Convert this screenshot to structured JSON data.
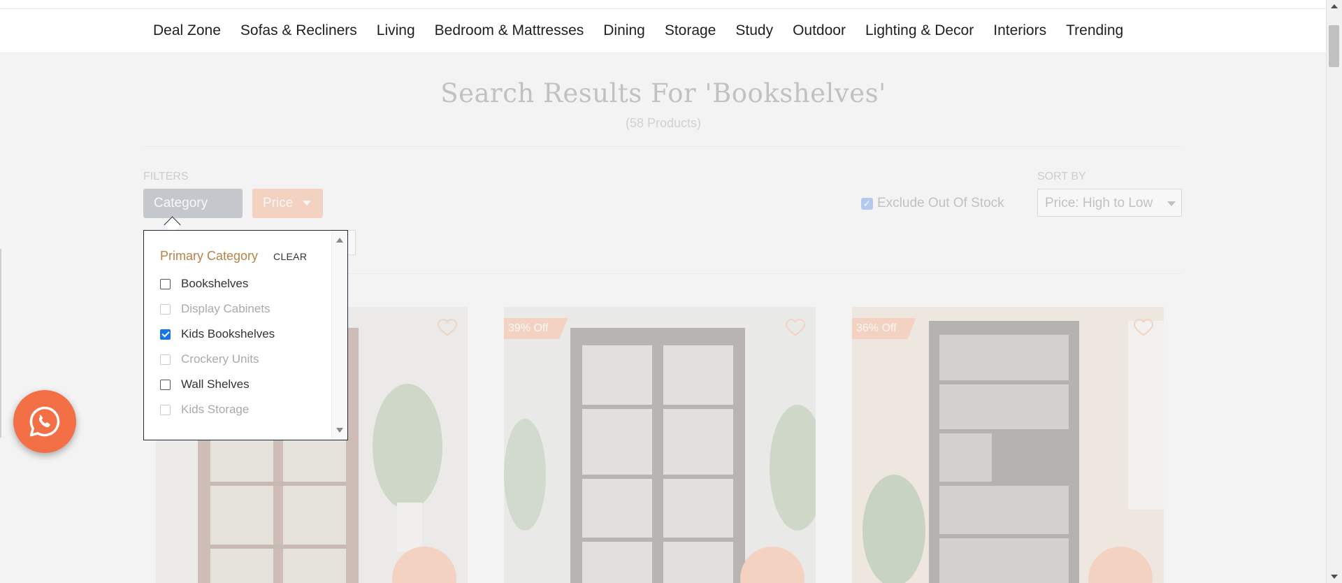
{
  "nav": {
    "items": [
      {
        "label": "Deal Zone"
      },
      {
        "label": "Sofas & Recliners"
      },
      {
        "label": "Living"
      },
      {
        "label": "Bedroom & Mattresses"
      },
      {
        "label": "Dining"
      },
      {
        "label": "Storage"
      },
      {
        "label": "Study"
      },
      {
        "label": "Outdoor"
      },
      {
        "label": "Lighting & Decor"
      },
      {
        "label": "Interiors"
      },
      {
        "label": "Trending"
      }
    ]
  },
  "search": {
    "title": "Search Results For 'Bookshelves'",
    "count": "(58 Products)"
  },
  "filters": {
    "label": "FILTERS",
    "category_button": "Category",
    "price_button": "Price",
    "exclude_out_of_stock": "Exclude Out Of Stock",
    "exclude_checked": true
  },
  "sort": {
    "label": "SORT BY",
    "selected": "Price: High to Low"
  },
  "category_popup": {
    "heading": "Primary Category",
    "clear_label": "CLEAR",
    "options": [
      {
        "label": "Bookshelves",
        "checked": false,
        "disabled": false
      },
      {
        "label": "Display Cabinets",
        "checked": false,
        "disabled": true
      },
      {
        "label": "Kids Bookshelves",
        "checked": true,
        "disabled": false
      },
      {
        "label": "Crockery Units",
        "checked": false,
        "disabled": true
      },
      {
        "label": "Wall Shelves",
        "checked": false,
        "disabled": false
      },
      {
        "label": "Kids Storage",
        "checked": false,
        "disabled": true
      }
    ]
  },
  "products": [
    {
      "badge": ""
    },
    {
      "badge": "39% Off"
    },
    {
      "badge": "36% Off"
    }
  ],
  "colors": {
    "accent": "#f38a5a",
    "category_button": "#5e6a77",
    "popup_heading": "#b8824a",
    "checkbox_checked": "#1a73e8",
    "whatsapp": "#f36f45"
  }
}
